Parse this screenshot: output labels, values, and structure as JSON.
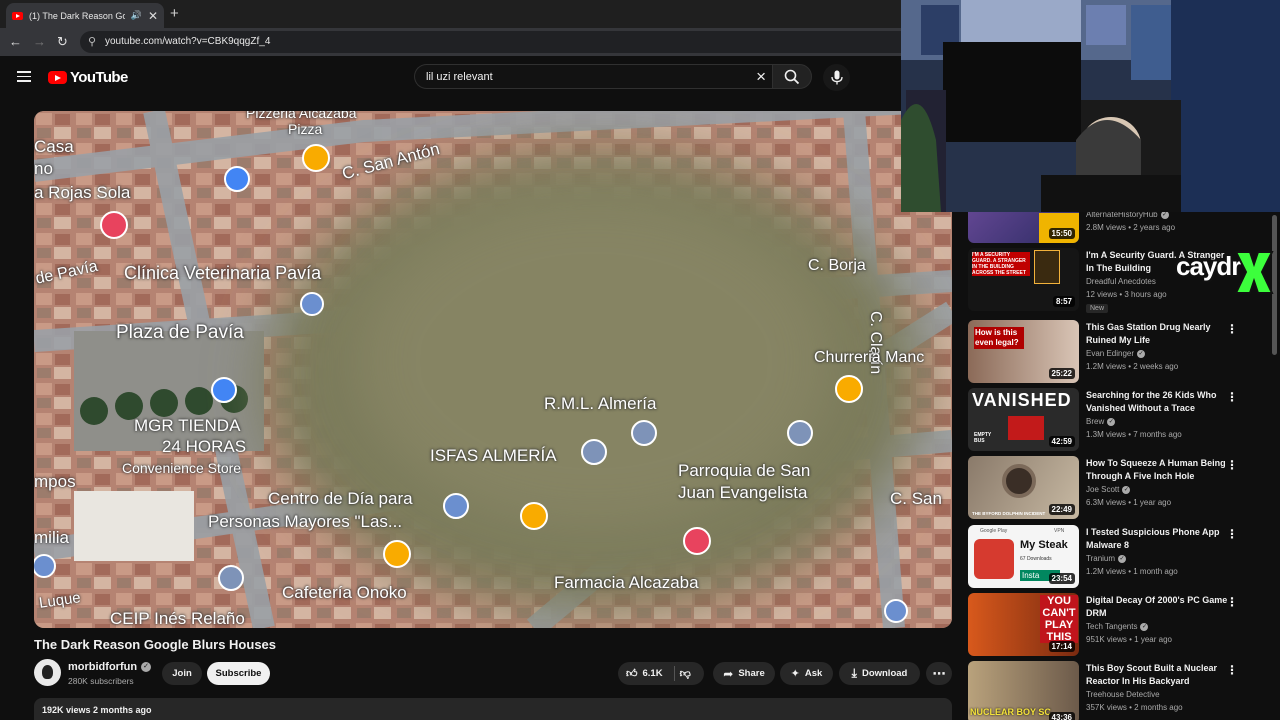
{
  "browser": {
    "tab_title": "(1) The Dark Reason Google Blurs Houses",
    "url": "youtube.com/watch?v=CBK9qqgZf_4"
  },
  "masthead": {
    "logo_text": "YouTube",
    "search_value": "lil uzi relevant"
  },
  "player": {
    "map_labels": {
      "pizzeria": "Pizzeria Alcazaba",
      "pizza": "Pizza",
      "casa": "Casa",
      "no": "no",
      "rojas": "a Rojas Sola",
      "san_anton": "C. San Antón",
      "clinica": "Clínica Veterinaria Pavía",
      "de_pavia": "de Pavía",
      "plaza": "Plaza de Pavía",
      "borja": "C. Borja",
      "clarin": "C. Clarín",
      "churreria": "Churreria Manc",
      "mgr1": "MGR TIENDA",
      "mgr2": "24 HORAS",
      "conv": "Convenience Store",
      "rml": "R.M.L. Almería",
      "isfas": "ISFAS ALMERÍA",
      "parroquia1": "Parroquia de San",
      "parroquia2": "Juan Evangelista",
      "pompos": "mpos",
      "centro1": "Centro de Día para",
      "centro2": "Personas Mayores \"Las...",
      "c_san": "C. San",
      "milia": "milia",
      "farmacia": "Farmacia Alcazaba",
      "luque": "Luque",
      "ceip": "CEIP Inés Relaño",
      "cafeteria": "Cafetería Onoko"
    }
  },
  "video": {
    "title": "The Dark Reason Google Blurs Houses",
    "channel": "morbidforfun",
    "subscribers": "280K subscribers",
    "join": "Join",
    "subscribe": "Subscribe",
    "likes": "6.1K",
    "share": "Share",
    "ask": "Ask",
    "download": "Download",
    "views_date": "192K views  2 months ago"
  },
  "sidebar": {
    "items": [
      {
        "title": "",
        "channel": "AlternateHistoryHub",
        "meta": "2.8M views • 2 years ago",
        "duration": "15:50"
      },
      {
        "title": "I'm A Security Guard. A Stranger In The Building",
        "channel": "Dreadful Anecdotes",
        "meta": "12 views • 3 hours ago",
        "duration": "8:57",
        "badge": "New"
      },
      {
        "title": "This Gas Station Drug Nearly Ruined My Life",
        "channel": "Evan Edinger",
        "meta": "1.2M views • 2 weeks ago",
        "duration": "25:22"
      },
      {
        "title": "Searching for the 26 Kids Who Vanished Without a Trace",
        "channel": "Brew",
        "meta": "1.3M views • 7 months ago",
        "duration": "42:59"
      },
      {
        "title": "How To Squeeze A Human Being Through A Five Inch Hole",
        "channel": "Joe Scott",
        "meta": "6.3M views • 1 year ago",
        "duration": "22:49"
      },
      {
        "title": "I Tested Suspicious Phone App Malware 8",
        "channel": "Tranium",
        "meta": "1.2M views • 1 month ago",
        "duration": "23:54"
      },
      {
        "title": "Digital Decay Of 2000's PC Game DRM",
        "channel": "Tech Tangents",
        "meta": "951K views • 1 year ago",
        "duration": "17:14"
      },
      {
        "title": "This Boy Scout Built a Nuclear Reactor In His Backyard",
        "channel": "Treehouse Detective",
        "meta": "357K views • 2 months ago",
        "duration": "43:36"
      }
    ],
    "thumb_texts": {
      "security_thumb": "I'M A SECURITY GUARD. A STRANGER IN THE BUILDING ACROSS THE STREET",
      "gas_thumb": "How is this even legal?",
      "vanished": "VANISHED",
      "empty_bus": "EMPTY BUS",
      "dolphin": "THE BYFORD DOLPHIN INCIDENT",
      "google_play": "Google Play",
      "vpn": "VPN",
      "my_steak": "My Steak",
      "downloads": "67 Downloads",
      "install": "Insta",
      "cant_play": "YOU CAN'T PLAY THIS",
      "nuclear": "NUCLEAR BOY SC"
    }
  },
  "webcam": {
    "overlay_text": "caydr"
  },
  "colors": {
    "accent": "#ff0000",
    "background": "#0f0f0f",
    "overlay_green": "#3cff3c"
  }
}
